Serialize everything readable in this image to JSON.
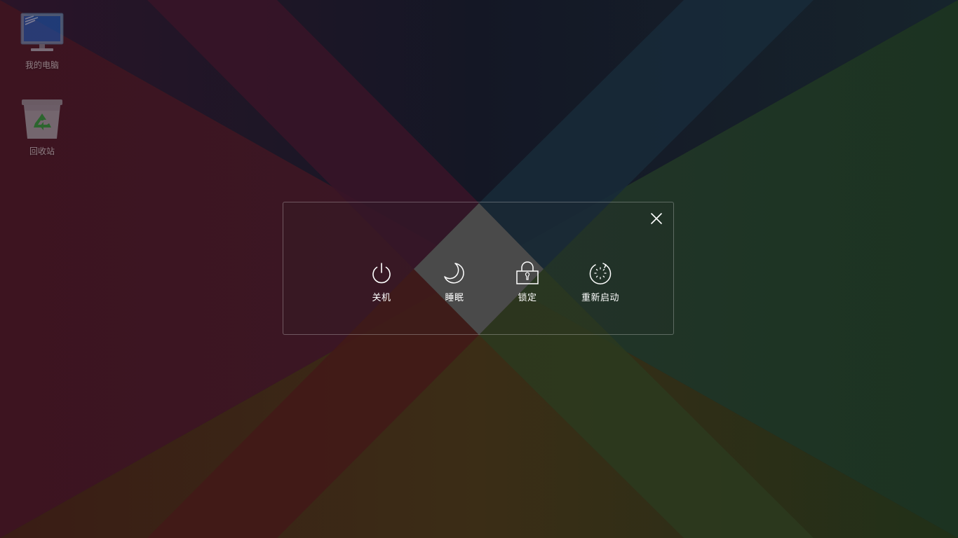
{
  "desktop": {
    "icons": [
      {
        "label": "我的电脑",
        "icon": "computer-icon"
      },
      {
        "label": "回收站",
        "icon": "recycle-bin-icon"
      }
    ],
    "wallpaper_colors": {
      "left": "#3f1520",
      "top": "#15192a",
      "right": "#1e3324",
      "bottom": "#3c2e16",
      "center": "#4a4a4a"
    }
  },
  "power_dialog": {
    "close_icon": "close-icon",
    "actions": [
      {
        "label": "关机",
        "icon": "power-icon"
      },
      {
        "label": "睡眠",
        "icon": "moon-icon"
      },
      {
        "label": "锁定",
        "icon": "lock-icon"
      },
      {
        "label": "重新启动",
        "icon": "restart-icon"
      }
    ]
  }
}
